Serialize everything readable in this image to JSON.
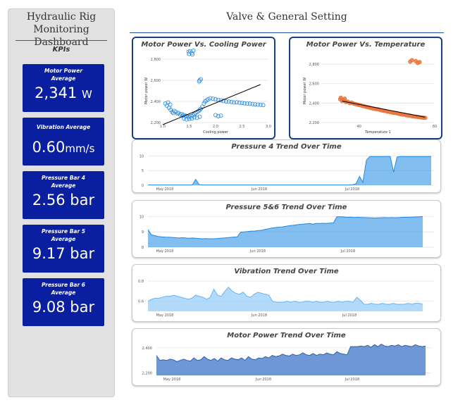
{
  "sidebar": {
    "title_line1": "Hydraulic Rig",
    "title_line2": "Monitoring Dashboard",
    "kpis_label": "KPIs",
    "cards": [
      {
        "label": "Motor Power Average",
        "value": "2,341",
        "unit": "W"
      },
      {
        "label": "Vibration Average",
        "value": "0.60",
        "unit": "mm/s"
      },
      {
        "label": "Pressure Bar 4 Average",
        "value": "2.56",
        "unit": "bar"
      },
      {
        "label": "Pressure Bar 5 Average",
        "value": "9.17",
        "unit": "bar"
      },
      {
        "label": "Pressure Bar 6 Average",
        "value": "9.08",
        "unit": "bar"
      }
    ]
  },
  "header": {
    "title": "Valve & General Setting"
  },
  "colors": {
    "kpi_bg": "#0a1fa0",
    "blue_series": "#1e88e5",
    "orange_series": "#e8743b",
    "trend_line": "#000000"
  },
  "chart_data": [
    {
      "type": "scatter",
      "title": "Motor Power Vs. Cooling Power",
      "xlabel": "Cooling power",
      "ylabel": "Motor power W",
      "xlim": [
        1.0,
        3.0
      ],
      "ylim": [
        2200,
        2800
      ],
      "xticks": [
        "1.0",
        "1.5",
        "2.0",
        "2.5",
        "3.0"
      ],
      "yticks": [
        "2,200",
        "2,400",
        "2,600",
        "2,800"
      ],
      "color": "#1e88e5",
      "trendline": [
        [
          1.0,
          2180
        ],
        [
          2.85,
          2560
        ]
      ],
      "points": [
        [
          1.49,
          2870
        ],
        [
          1.52,
          2875
        ],
        [
          1.55,
          2860
        ],
        [
          1.58,
          2880
        ],
        [
          1.5,
          2850
        ],
        [
          1.56,
          2845
        ],
        [
          1.05,
          2380
        ],
        [
          1.08,
          2360
        ],
        [
          1.12,
          2340
        ],
        [
          1.15,
          2320
        ],
        [
          1.18,
          2300
        ],
        [
          1.2,
          2290
        ],
        [
          1.22,
          2310
        ],
        [
          1.25,
          2300
        ],
        [
          1.28,
          2285
        ],
        [
          1.3,
          2290
        ],
        [
          1.33,
          2275
        ],
        [
          1.36,
          2280
        ],
        [
          1.38,
          2265
        ],
        [
          1.4,
          2270
        ],
        [
          1.42,
          2260
        ],
        [
          1.45,
          2262
        ],
        [
          1.48,
          2255
        ],
        [
          1.5,
          2250
        ],
        [
          1.52,
          2258
        ],
        [
          1.55,
          2262
        ],
        [
          1.58,
          2270
        ],
        [
          1.6,
          2280
        ],
        [
          1.62,
          2290
        ],
        [
          1.65,
          2300
        ],
        [
          1.68,
          2310
        ],
        [
          1.7,
          2320
        ],
        [
          1.72,
          2330
        ],
        [
          1.75,
          2350
        ],
        [
          1.78,
          2380
        ],
        [
          1.8,
          2400
        ],
        [
          1.83,
          2410
        ],
        [
          1.86,
          2420
        ],
        [
          1.9,
          2430
        ],
        [
          1.95,
          2425
        ],
        [
          2.0,
          2420
        ],
        [
          2.05,
          2415
        ],
        [
          2.1,
          2410
        ],
        [
          2.15,
          2405
        ],
        [
          2.2,
          2400
        ],
        [
          2.25,
          2398
        ],
        [
          2.3,
          2395
        ],
        [
          2.35,
          2390
        ],
        [
          2.4,
          2392
        ],
        [
          2.45,
          2388
        ],
        [
          2.5,
          2385
        ],
        [
          2.55,
          2382
        ],
        [
          2.6,
          2380
        ],
        [
          2.65,
          2378
        ],
        [
          2.7,
          2375
        ],
        [
          2.75,
          2372
        ],
        [
          2.8,
          2370
        ],
        [
          2.85,
          2368
        ],
        [
          2.9,
          2365
        ],
        [
          1.1,
          2390
        ],
        [
          1.14,
          2370
        ],
        [
          1.4,
          2240
        ],
        [
          1.45,
          2230
        ],
        [
          1.5,
          2235
        ],
        [
          1.55,
          2240
        ],
        [
          1.6,
          2250
        ],
        [
          1.65,
          2245
        ],
        [
          1.7,
          2255
        ],
        [
          2.0,
          2270
        ],
        [
          2.05,
          2260
        ],
        [
          2.1,
          2265
        ],
        [
          1.7,
          2600
        ],
        [
          1.72,
          2610
        ],
        [
          1.69,
          2590
        ]
      ]
    },
    {
      "type": "scatter",
      "title": "Motor Power Vs. Temperature",
      "xlabel": "Temperature 1",
      "ylabel": "Motor power W",
      "xlim": [
        30,
        60
      ],
      "ylim": [
        2200,
        2850
      ],
      "xticks": [
        "40",
        "60"
      ],
      "yticks": [
        "2,200",
        "2,400",
        "2,600",
        "2,800"
      ],
      "color": "#e8743b",
      "trendline": [
        [
          35.5,
          2420
        ],
        [
          57.5,
          2255
        ]
      ],
      "points": [
        [
          35,
          2440
        ],
        [
          35.5,
          2420
        ],
        [
          36,
          2430
        ],
        [
          36.5,
          2410
        ],
        [
          37,
          2415
        ],
        [
          37.5,
          2400
        ],
        [
          38,
          2405
        ],
        [
          38.5,
          2395
        ],
        [
          39,
          2390
        ],
        [
          39.5,
          2385
        ],
        [
          40,
          2380
        ],
        [
          40.5,
          2375
        ],
        [
          41,
          2370
        ],
        [
          41.5,
          2365
        ],
        [
          42,
          2360
        ],
        [
          42.5,
          2355
        ],
        [
          43,
          2350
        ],
        [
          43.5,
          2345
        ],
        [
          44,
          2342
        ],
        [
          44.5,
          2338
        ],
        [
          45,
          2335
        ],
        [
          45.5,
          2330
        ],
        [
          46,
          2325
        ],
        [
          46.5,
          2320
        ],
        [
          47,
          2318
        ],
        [
          47.5,
          2312
        ],
        [
          48,
          2310
        ],
        [
          48.5,
          2305
        ],
        [
          49,
          2300
        ],
        [
          49.5,
          2298
        ],
        [
          50,
          2295
        ],
        [
          50.5,
          2290
        ],
        [
          51,
          2285
        ],
        [
          51.5,
          2282
        ],
        [
          52,
          2280
        ],
        [
          52.5,
          2275
        ],
        [
          53,
          2272
        ],
        [
          53.5,
          2270
        ],
        [
          54,
          2265
        ],
        [
          54.5,
          2262
        ],
        [
          55,
          2260
        ],
        [
          55.5,
          2258
        ],
        [
          56,
          2255
        ],
        [
          56.5,
          2252
        ],
        [
          57,
          2250
        ],
        [
          57.5,
          2248
        ],
        [
          35.2,
          2455
        ],
        [
          36.2,
          2445
        ],
        [
          54,
          2840
        ],
        [
          55,
          2830
        ],
        [
          56,
          2820
        ],
        [
          53.5,
          2825
        ],
        [
          55.5,
          2810
        ]
      ]
    },
    {
      "type": "area",
      "title": "Pressure 4 Trend Over Time",
      "x_labels": [
        "May 2018",
        "Jun 2018",
        "Jul 2018"
      ],
      "yticks": [
        "0",
        "5",
        "10"
      ],
      "ylim": [
        0,
        12
      ],
      "color": "#1e88e5",
      "values": [
        0.1,
        0.1,
        0.1,
        0.1,
        0.1,
        0.1,
        0.1,
        0.1,
        0.1,
        0.1,
        0.1,
        0.1,
        0.1,
        0.1,
        2.0,
        0.2,
        0.1,
        0.1,
        0.1,
        0.1,
        0.1,
        0.1,
        0.1,
        0.1,
        0.1,
        0.1,
        0.1,
        0.1,
        0.1,
        0.1,
        0.1,
        0.1,
        0.1,
        0.1,
        0.1,
        0.1,
        0.1,
        0.1,
        0.1,
        0.1,
        0.1,
        0.1,
        0.1,
        0.1,
        0.1,
        0.1,
        0.1,
        0.1,
        0.1,
        0.1,
        0.1,
        0.1,
        0.1,
        0.1,
        0.1,
        0.1,
        0.1,
        0.1,
        0.1,
        0.1,
        0.2,
        0.5,
        3.0,
        1.0,
        8.5,
        9.8,
        9.8,
        9.8,
        9.8,
        9.8,
        9.8,
        9.8,
        4.5,
        9.6,
        9.8,
        9.8,
        9.8,
        9.8,
        9.8,
        9.8,
        9.8,
        9.8,
        9.8,
        9.8
      ]
    },
    {
      "type": "area",
      "title": "Pressure 5&6 Trend Over Time",
      "x_labels": [
        "May 2018",
        "Jun 2018",
        "Jul 2018"
      ],
      "yticks": [
        "8",
        "9",
        "10"
      ],
      "ylim": [
        8,
        10.2
      ],
      "color": "#1e88e5",
      "values": [
        9.15,
        8.8,
        8.75,
        8.7,
        8.68,
        8.66,
        8.65,
        8.64,
        8.62,
        8.6,
        8.62,
        8.6,
        8.58,
        8.6,
        8.58,
        8.56,
        8.55,
        8.56,
        8.55,
        8.55,
        8.56,
        8.58,
        8.6,
        8.62,
        8.64,
        8.66,
        8.68,
        8.98,
        9.0,
        9.02,
        9.05,
        9.05,
        9.08,
        9.1,
        9.15,
        9.2,
        9.25,
        9.28,
        9.3,
        9.32,
        9.35,
        9.4,
        9.42,
        9.45,
        9.48,
        9.5,
        9.52,
        9.55,
        9.5,
        9.55,
        9.55,
        9.56,
        9.55,
        9.57,
        9.58,
        9.98,
        9.98,
        9.97,
        9.95,
        9.96,
        9.94,
        9.95,
        9.94,
        9.93,
        9.92,
        9.91,
        9.9,
        9.91,
        9.92,
        9.93,
        9.92,
        9.93,
        9.92,
        9.93,
        9.95,
        9.95,
        9.96,
        9.96,
        9.97,
        9.98,
        10.0
      ]
    },
    {
      "type": "area",
      "title": "Vibration Trend Over Time",
      "x_labels": [
        "May 2018",
        "Jun 2018",
        "Jul 2018"
      ],
      "yticks": [
        "0.6",
        "0.8"
      ],
      "ylim": [
        0.5,
        0.85
      ],
      "color": "#90caf9",
      "values": [
        0.6,
        0.62,
        0.63,
        0.63,
        0.64,
        0.65,
        0.65,
        0.66,
        0.65,
        0.64,
        0.63,
        0.62,
        0.63,
        0.66,
        0.65,
        0.64,
        0.62,
        0.64,
        0.72,
        0.66,
        0.65,
        0.7,
        0.74,
        0.7,
        0.68,
        0.67,
        0.69,
        0.65,
        0.64,
        0.67,
        0.69,
        0.68,
        0.67,
        0.66,
        0.6,
        0.59,
        0.59,
        0.59,
        0.6,
        0.59,
        0.6,
        0.59,
        0.59,
        0.6,
        0.6,
        0.59,
        0.6,
        0.59,
        0.59,
        0.6,
        0.59,
        0.59,
        0.6,
        0.59,
        0.6,
        0.6,
        0.59,
        0.64,
        0.61,
        0.57,
        0.57,
        0.58,
        0.57,
        0.57,
        0.58,
        0.57,
        0.57,
        0.58,
        0.57,
        0.57,
        0.57,
        0.58,
        0.57,
        0.58,
        0.58,
        0.57
      ]
    },
    {
      "type": "area",
      "title": "Motor Power Trend Over Time",
      "x_labels": [
        "May 2018",
        "Jun 2018",
        "Jul 2018"
      ],
      "yticks": [
        "2,200",
        "2,400"
      ],
      "ylim": [
        2180,
        2450
      ],
      "color": "#5b8fd6",
      "values": [
        2340,
        2300,
        2305,
        2300,
        2310,
        2305,
        2290,
        2300,
        2310,
        2300,
        2295,
        2320,
        2300,
        2305,
        2330,
        2310,
        2300,
        2315,
        2295,
        2320,
        2305,
        2300,
        2320,
        2310,
        2305,
        2320,
        2300,
        2330,
        2310,
        2305,
        2320,
        2315,
        2330,
        2320,
        2340,
        2330,
        2335,
        2350,
        2340,
        2335,
        2350,
        2340,
        2345,
        2360,
        2345,
        2340,
        2355,
        2340,
        2350,
        2345,
        2360,
        2350,
        2345,
        2370,
        2355,
        2350,
        2345,
        2410,
        2410,
        2410,
        2415,
        2410,
        2420,
        2405,
        2425,
        2410,
        2430,
        2415,
        2410,
        2420,
        2415,
        2425,
        2410,
        2420,
        2415,
        2410,
        2425,
        2415,
        2410,
        2415
      ]
    }
  ]
}
